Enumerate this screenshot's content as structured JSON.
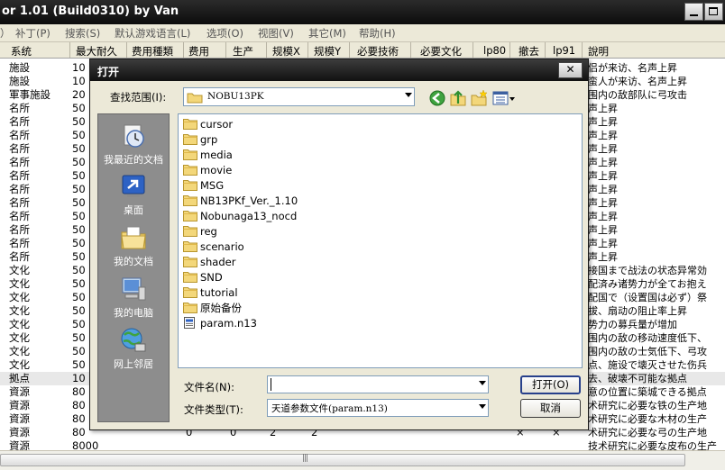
{
  "window": {
    "title": "or 1.01 (Build0310) by Van"
  },
  "menu": [
    "）",
    "补丁(P)",
    "搜索(S)",
    "默认游戏语言(L)",
    "选项(O)",
    "视图(V)",
    "其它(M)",
    "帮助(H)"
  ],
  "columns": [
    "系统",
    "最大耐久",
    "费用種類",
    "费用",
    "生产",
    "规模X",
    "规模Y",
    "必要技術",
    "必要文化",
    "lp80",
    "撤去",
    "lp91",
    "說明"
  ],
  "rows": [
    {
      "system": "施設",
      "durability": "10"
    },
    {
      "system": "施設",
      "durability": "10"
    },
    {
      "system": "軍事施設",
      "durability": "20"
    },
    {
      "system": "名所",
      "durability": "50"
    },
    {
      "system": "名所",
      "durability": "50"
    },
    {
      "system": "名所",
      "durability": "50"
    },
    {
      "system": "名所",
      "durability": "50"
    },
    {
      "system": "名所",
      "durability": "50"
    },
    {
      "system": "名所",
      "durability": "50"
    },
    {
      "system": "名所",
      "durability": "50"
    },
    {
      "system": "名所",
      "durability": "50"
    },
    {
      "system": "名所",
      "durability": "50"
    },
    {
      "system": "名所",
      "durability": "50"
    },
    {
      "system": "名所",
      "durability": "50"
    },
    {
      "system": "名所",
      "durability": "50"
    },
    {
      "system": "文化",
      "durability": "50"
    },
    {
      "system": "文化",
      "durability": "50"
    },
    {
      "system": "文化",
      "durability": "50"
    },
    {
      "system": "文化",
      "durability": "50"
    },
    {
      "system": "文化",
      "durability": "50"
    },
    {
      "system": "文化",
      "durability": "50"
    },
    {
      "system": "文化",
      "durability": "50"
    },
    {
      "system": "文化",
      "durability": "50"
    },
    {
      "system": "拠点",
      "durability": "10"
    },
    {
      "system": "資源",
      "durability": "80"
    },
    {
      "system": "資源",
      "durability": "80"
    },
    {
      "system": "資源",
      "durability": "80"
    },
    {
      "system": "資源",
      "durability": "80"
    },
    {
      "system": "資源",
      "durability": "8000"
    }
  ],
  "last_row_extra": {
    "cost": "0",
    "prod": "0",
    "sx": "2",
    "sy": "2",
    "remove": "×",
    "lp91": "×"
  },
  "descriptions": [
    "侣が来访、名声上昇",
    "蛮人が来访、名声上昇",
    "围内の敌部队に弓攻击",
    "声上昇",
    "声上昇",
    "声上昇",
    "声上昇",
    "声上昇",
    "声上昇",
    "声上昇",
    "声上昇",
    "声上昇",
    "声上昇",
    "声上昇",
    "声上昇",
    "接国まで战法の状态异常効",
    "配済み诸势力が全てお抱え",
    "配国で（设置国は必ず）祭",
    "拔、扇动の阻止率上昇",
    "势力の募兵量が增加",
    "围内の敌の移动速度低下、",
    "围内の敌の士気低下、弓攻",
    "点、施设で壊灭させた伤兵",
    "去、破壊不可能な拠点",
    "意の位置に築城できる拠点",
    "术研究に必要な铁の生产地",
    "术研究に必要な木材の生产",
    "术研究に必要な弓の生产地",
    "技术研究に必要な皮布の生产"
  ],
  "dialog": {
    "title": "打开",
    "look_in_label": "查找范围(I):",
    "look_in_value": "NOBU13PK",
    "places": [
      "我最近的文档",
      "桌面",
      "我的文档",
      "我的电脑",
      "网上邻居"
    ],
    "files": [
      {
        "name": "cursor",
        "type": "folder"
      },
      {
        "name": "grp",
        "type": "folder"
      },
      {
        "name": "media",
        "type": "folder"
      },
      {
        "name": "movie",
        "type": "folder"
      },
      {
        "name": "MSG",
        "type": "folder"
      },
      {
        "name": "NB13PKf_Ver._1.10",
        "type": "folder"
      },
      {
        "name": "Nobunaga13_nocd",
        "type": "folder"
      },
      {
        "name": "reg",
        "type": "folder"
      },
      {
        "name": "scenario",
        "type": "folder"
      },
      {
        "name": "shader",
        "type": "folder"
      },
      {
        "name": "SND",
        "type": "folder"
      },
      {
        "name": "tutorial",
        "type": "folder"
      },
      {
        "name": "原始备份",
        "type": "folder"
      },
      {
        "name": "param.n13",
        "type": "file"
      }
    ],
    "filename_label": "文件名(N):",
    "filename_value": "",
    "filetype_label": "文件类型(T):",
    "filetype_value": "天道参数文件(param.n13)",
    "open_button": "打开(O)",
    "cancel_button": "取消",
    "close_glyph": "✕"
  },
  "scrollbar_glyph": "|||"
}
